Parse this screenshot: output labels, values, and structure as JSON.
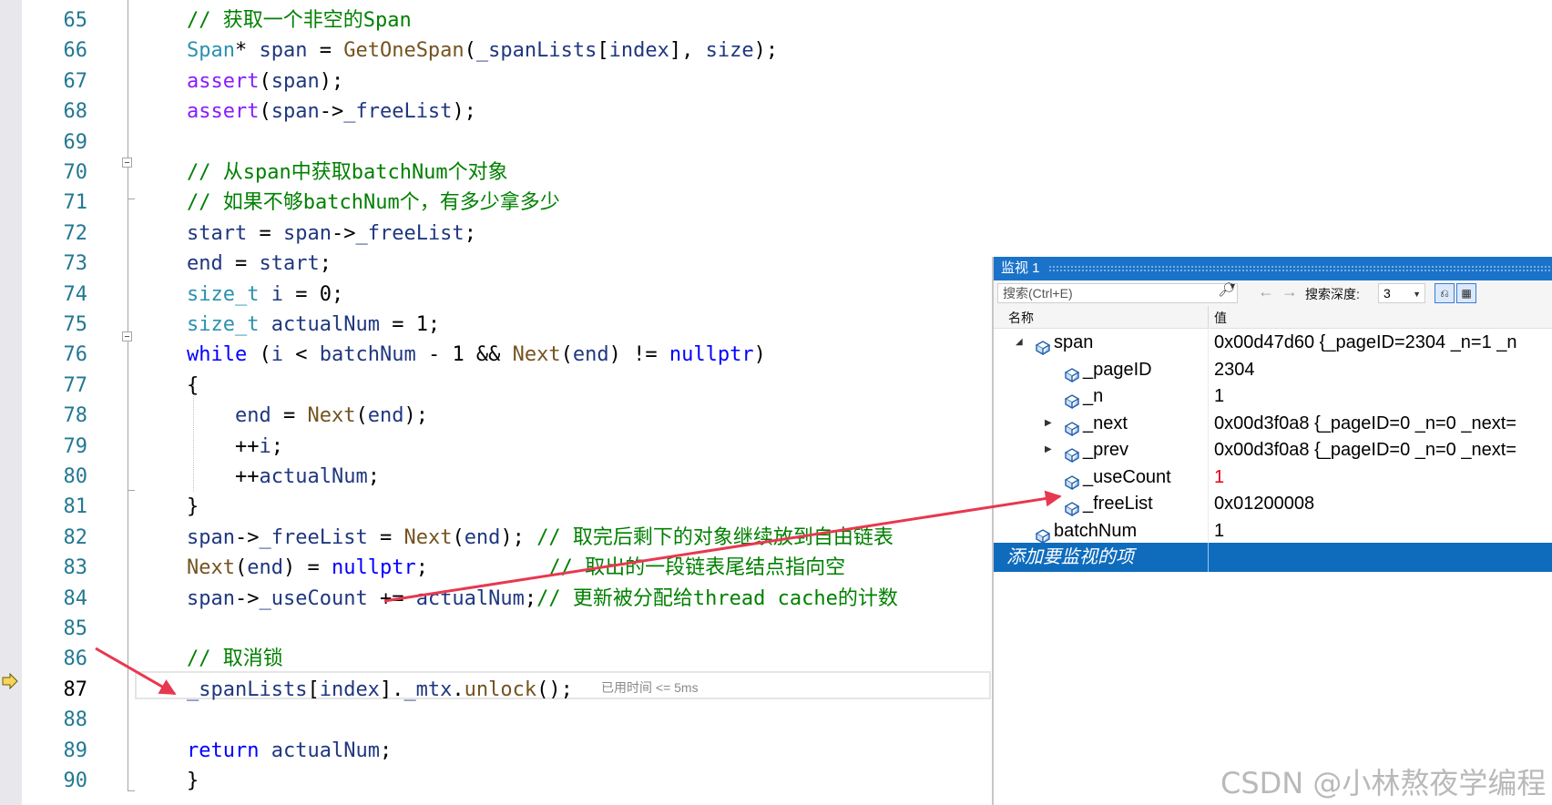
{
  "editor": {
    "lines": [
      {
        "no": "65",
        "segs": [
          {
            "t": "// 获取一个非空的Span",
            "c": "cm"
          }
        ]
      },
      {
        "no": "66",
        "segs": [
          {
            "t": "Span",
            "c": "ty"
          },
          {
            "t": "* ",
            "c": "nm"
          },
          {
            "t": "span",
            "c": "id"
          },
          {
            "t": " = ",
            "c": "nm"
          },
          {
            "t": "GetOneSpan",
            "c": "fn"
          },
          {
            "t": "(",
            "c": "nm"
          },
          {
            "t": "_spanLists",
            "c": "id"
          },
          {
            "t": "[",
            "c": "nm"
          },
          {
            "t": "index",
            "c": "id"
          },
          {
            "t": "], ",
            "c": "nm"
          },
          {
            "t": "size",
            "c": "id"
          },
          {
            "t": ");",
            "c": "nm"
          }
        ]
      },
      {
        "no": "67",
        "segs": [
          {
            "t": "assert",
            "c": "mb"
          },
          {
            "t": "(",
            "c": "nm"
          },
          {
            "t": "span",
            "c": "id"
          },
          {
            "t": ");",
            "c": "nm"
          }
        ]
      },
      {
        "no": "68",
        "segs": [
          {
            "t": "assert",
            "c": "mb"
          },
          {
            "t": "(",
            "c": "nm"
          },
          {
            "t": "span",
            "c": "id"
          },
          {
            "t": "->",
            "c": "nm"
          },
          {
            "t": "_freeList",
            "c": "id"
          },
          {
            "t": ");",
            "c": "nm"
          }
        ]
      },
      {
        "no": "69",
        "segs": []
      },
      {
        "no": "70",
        "segs": [
          {
            "t": "// 从span中获取batchNum个对象",
            "c": "cm"
          }
        ]
      },
      {
        "no": "71",
        "segs": [
          {
            "t": "// 如果不够batchNum个，有多少拿多少",
            "c": "cm"
          }
        ]
      },
      {
        "no": "72",
        "segs": [
          {
            "t": "start",
            "c": "id"
          },
          {
            "t": " = ",
            "c": "nm"
          },
          {
            "t": "span",
            "c": "id"
          },
          {
            "t": "->",
            "c": "nm"
          },
          {
            "t": "_freeList",
            "c": "id"
          },
          {
            "t": ";",
            "c": "nm"
          }
        ]
      },
      {
        "no": "73",
        "segs": [
          {
            "t": "end",
            "c": "id"
          },
          {
            "t": " = ",
            "c": "nm"
          },
          {
            "t": "start",
            "c": "id"
          },
          {
            "t": ";",
            "c": "nm"
          }
        ]
      },
      {
        "no": "74",
        "segs": [
          {
            "t": "size_t",
            "c": "ty"
          },
          {
            "t": " ",
            "c": "nm"
          },
          {
            "t": "i",
            "c": "id"
          },
          {
            "t": " = 0;",
            "c": "nm"
          }
        ]
      },
      {
        "no": "75",
        "segs": [
          {
            "t": "size_t",
            "c": "ty"
          },
          {
            "t": " ",
            "c": "nm"
          },
          {
            "t": "actualNum",
            "c": "id"
          },
          {
            "t": " = 1;",
            "c": "nm"
          }
        ]
      },
      {
        "no": "76",
        "segs": [
          {
            "t": "while",
            "c": "kw"
          },
          {
            "t": " (",
            "c": "nm"
          },
          {
            "t": "i",
            "c": "id"
          },
          {
            "t": " < ",
            "c": "nm"
          },
          {
            "t": "batchNum",
            "c": "id"
          },
          {
            "t": " - 1 && ",
            "c": "nm"
          },
          {
            "t": "Next",
            "c": "fn"
          },
          {
            "t": "(",
            "c": "nm"
          },
          {
            "t": "end",
            "c": "id"
          },
          {
            "t": ") != ",
            "c": "nm"
          },
          {
            "t": "nullptr",
            "c": "kw"
          },
          {
            "t": ")",
            "c": "nm"
          }
        ]
      },
      {
        "no": "77",
        "segs": [
          {
            "t": "{",
            "c": "nm"
          }
        ]
      },
      {
        "no": "78",
        "segs": [
          {
            "t": "    ",
            "c": "nm"
          },
          {
            "t": "end",
            "c": "id"
          },
          {
            "t": " = ",
            "c": "nm"
          },
          {
            "t": "Next",
            "c": "fn"
          },
          {
            "t": "(",
            "c": "nm"
          },
          {
            "t": "end",
            "c": "id"
          },
          {
            "t": ");",
            "c": "nm"
          }
        ]
      },
      {
        "no": "79",
        "segs": [
          {
            "t": "    ++",
            "c": "nm"
          },
          {
            "t": "i",
            "c": "id"
          },
          {
            "t": ";",
            "c": "nm"
          }
        ]
      },
      {
        "no": "80",
        "segs": [
          {
            "t": "    ++",
            "c": "nm"
          },
          {
            "t": "actualNum",
            "c": "id"
          },
          {
            "t": ";",
            "c": "nm"
          }
        ]
      },
      {
        "no": "81",
        "segs": [
          {
            "t": "}",
            "c": "nm"
          }
        ]
      },
      {
        "no": "82",
        "segs": [
          {
            "t": "span",
            "c": "id"
          },
          {
            "t": "->",
            "c": "nm"
          },
          {
            "t": "_freeList",
            "c": "id"
          },
          {
            "t": " = ",
            "c": "nm"
          },
          {
            "t": "Next",
            "c": "fn"
          },
          {
            "t": "(",
            "c": "nm"
          },
          {
            "t": "end",
            "c": "id"
          },
          {
            "t": "); ",
            "c": "nm"
          },
          {
            "t": "// 取完后剩下的对象继续放到自由链表",
            "c": "cm"
          }
        ]
      },
      {
        "no": "83",
        "segs": [
          {
            "t": "Next",
            "c": "fn"
          },
          {
            "t": "(",
            "c": "nm"
          },
          {
            "t": "end",
            "c": "id"
          },
          {
            "t": ") = ",
            "c": "nm"
          },
          {
            "t": "nullptr",
            "c": "kw"
          },
          {
            "t": ";          ",
            "c": "nm"
          },
          {
            "t": "// 取出的一段链表尾结点指向空",
            "c": "cm"
          }
        ]
      },
      {
        "no": "84",
        "segs": [
          {
            "t": "span",
            "c": "id"
          },
          {
            "t": "->",
            "c": "nm"
          },
          {
            "t": "_useCount",
            "c": "id"
          },
          {
            "t": " += ",
            "c": "nm"
          },
          {
            "t": "actualNum",
            "c": "id"
          },
          {
            "t": ";",
            "c": "nm"
          },
          {
            "t": "// 更新被分配给thread cache的计数",
            "c": "cm"
          }
        ]
      },
      {
        "no": "85",
        "segs": []
      },
      {
        "no": "86",
        "segs": [
          {
            "t": "// 取消锁",
            "c": "cm"
          }
        ]
      },
      {
        "no": "87",
        "segs": [
          {
            "t": "_spanLists",
            "c": "id"
          },
          {
            "t": "[",
            "c": "nm"
          },
          {
            "t": "index",
            "c": "id"
          },
          {
            "t": "].",
            "c": "nm"
          },
          {
            "t": "_mtx",
            "c": "id"
          },
          {
            "t": ".",
            "c": "nm"
          },
          {
            "t": "unlock",
            "c": "fn"
          },
          {
            "t": "();",
            "c": "nm"
          }
        ]
      },
      {
        "no": "88",
        "segs": []
      },
      {
        "no": "89",
        "segs": [
          {
            "t": "return",
            "c": "kw"
          },
          {
            "t": " ",
            "c": "nm"
          },
          {
            "t": "actualNum",
            "c": "id"
          },
          {
            "t": ";",
            "c": "nm"
          }
        ]
      },
      {
        "no": "90",
        "segs": [
          {
            "t": "}",
            "c": "nm"
          }
        ]
      }
    ],
    "current_line": "87",
    "elapsed_hint": "已用时间 <= 5ms"
  },
  "watch": {
    "title": "监视 1",
    "search_placeholder": "搜索(Ctrl+E)",
    "depth_label": "搜索深度:",
    "depth_value": "3",
    "col_name": "名称",
    "col_value": "值",
    "rows": [
      {
        "name": "span",
        "value": "0x00d47d60 {_pageID=2304 _n=1 _n",
        "level": 0,
        "expander": "expanded",
        "changed": false
      },
      {
        "name": "_pageID",
        "value": "2304",
        "level": 1,
        "expander": "none",
        "changed": false
      },
      {
        "name": "_n",
        "value": "1",
        "level": 1,
        "expander": "none",
        "changed": false
      },
      {
        "name": "_next",
        "value": "0x00d3f0a8 {_pageID=0 _n=0 _next=",
        "level": 1,
        "expander": "collapsed",
        "changed": false
      },
      {
        "name": "_prev",
        "value": "0x00d3f0a8 {_pageID=0 _n=0 _next=",
        "level": 1,
        "expander": "collapsed",
        "changed": false
      },
      {
        "name": "_useCount",
        "value": "1",
        "level": 1,
        "expander": "none",
        "changed": true
      },
      {
        "name": "_freeList",
        "value": "0x01200008",
        "level": 1,
        "expander": "none",
        "changed": false
      },
      {
        "name": "batchNum",
        "value": "1",
        "level": 0,
        "expander": "none",
        "changed": false
      }
    ],
    "add_item_label": "添加要监视的项"
  },
  "watermark": "CSDN @小林熬夜学编程",
  "colors": {
    "accent": "#1a73c9",
    "selection": "#0f6cbd",
    "annotation": "#e8384f",
    "changed_value": "#e8000b"
  },
  "icons": [
    "execution-pointer-icon",
    "search-icon",
    "member-field-icon",
    "expand-arrow-icon",
    "collapse-arrow-icon",
    "back-arrow-icon",
    "forward-arrow-icon",
    "pin-icon",
    "hex-display-icon"
  ]
}
